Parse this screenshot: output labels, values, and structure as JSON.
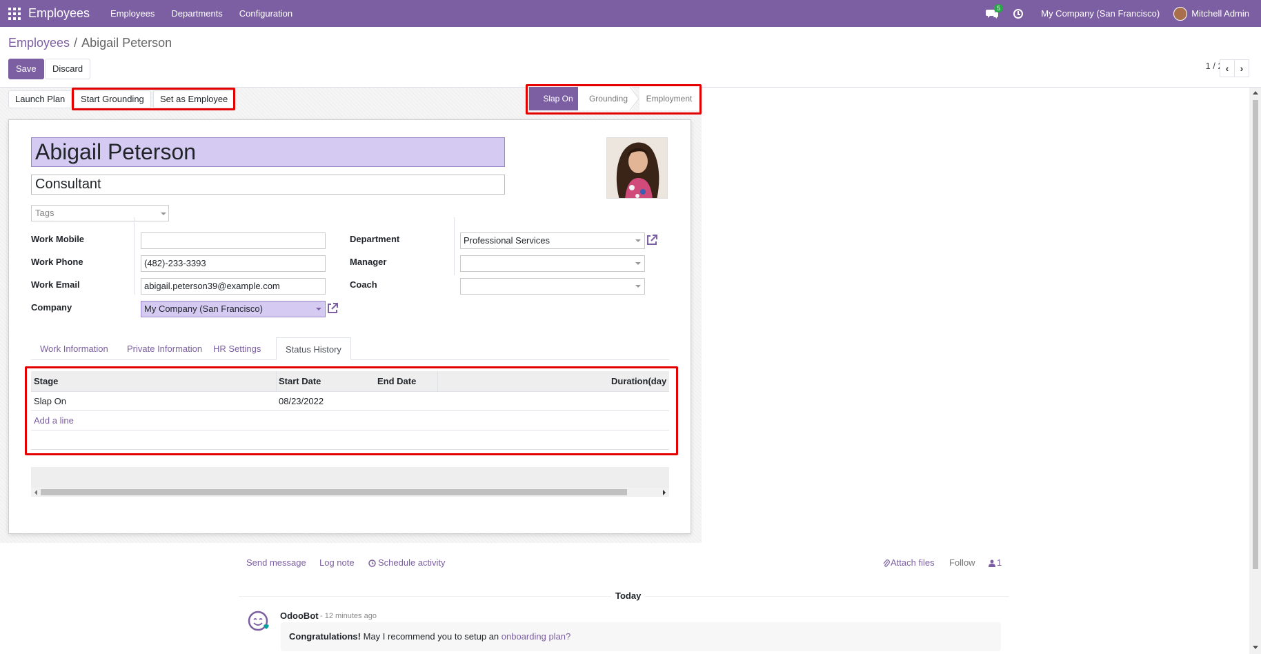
{
  "navbar": {
    "app_name": "Employees",
    "menu": [
      "Employees",
      "Departments",
      "Configuration"
    ],
    "messages_badge": "5",
    "company": "My Company (San Francisco)",
    "user": "Mitchell Admin",
    "icons": [
      "apps-icon",
      "chat-icon",
      "clock-icon",
      "user-avatar"
    ]
  },
  "breadcrumb": {
    "parent": "Employees",
    "separator": "/",
    "current": "Abigail Peterson"
  },
  "actions": {
    "save": "Save",
    "discard": "Discard"
  },
  "pager": {
    "value": "1 / 20"
  },
  "header_buttons": {
    "launch_plan": "Launch Plan",
    "start_grounding": "Start Grounding",
    "set_as_employee": "Set as Employee"
  },
  "statusbar": {
    "stages": [
      "Slap On",
      "Grounding",
      "Employment"
    ],
    "active": "Slap On"
  },
  "employee": {
    "name": "Abigail Peterson",
    "job_title": "Consultant",
    "tags_placeholder": "Tags"
  },
  "fields": {
    "work_mobile_label": "Work Mobile",
    "work_mobile_value": "",
    "work_phone_label": "Work Phone",
    "work_phone_value": "(482)-233-3393",
    "work_email_label": "Work Email",
    "work_email_value": "abigail.peterson39@example.com",
    "company_label": "Company",
    "company_value": "My Company (San Francisco)",
    "department_label": "Department",
    "department_value": "Professional Services",
    "manager_label": "Manager",
    "manager_value": "",
    "coach_label": "Coach",
    "coach_value": ""
  },
  "tabs": [
    "Work Information",
    "Private Information",
    "HR Settings",
    "Status History"
  ],
  "active_tab": "Status History",
  "status_history": {
    "columns": [
      "Stage",
      "Start Date",
      "End Date",
      "Duration(day"
    ],
    "rows": [
      {
        "stage": "Slap On",
        "start_date": "08/23/2022",
        "end_date": "",
        "duration": ""
      }
    ],
    "add_line": "Add a line"
  },
  "chatter": {
    "send_message": "Send message",
    "log_note": "Log note",
    "schedule_activity": "Schedule activity",
    "attach_files": "Attach files",
    "follow": "Follow",
    "followers_count": "1",
    "date_separator": "Today",
    "message": {
      "author": "OdooBot",
      "time": "- 12 minutes ago",
      "bold": "Congratulations!",
      "text": " May I recommend you to setup an ",
      "link": "onboarding plan?"
    }
  },
  "colors": {
    "brand": "#7c5fa2",
    "highlight": "#d5cbf2",
    "annotation": "#e50000",
    "badge": "#28a745"
  }
}
